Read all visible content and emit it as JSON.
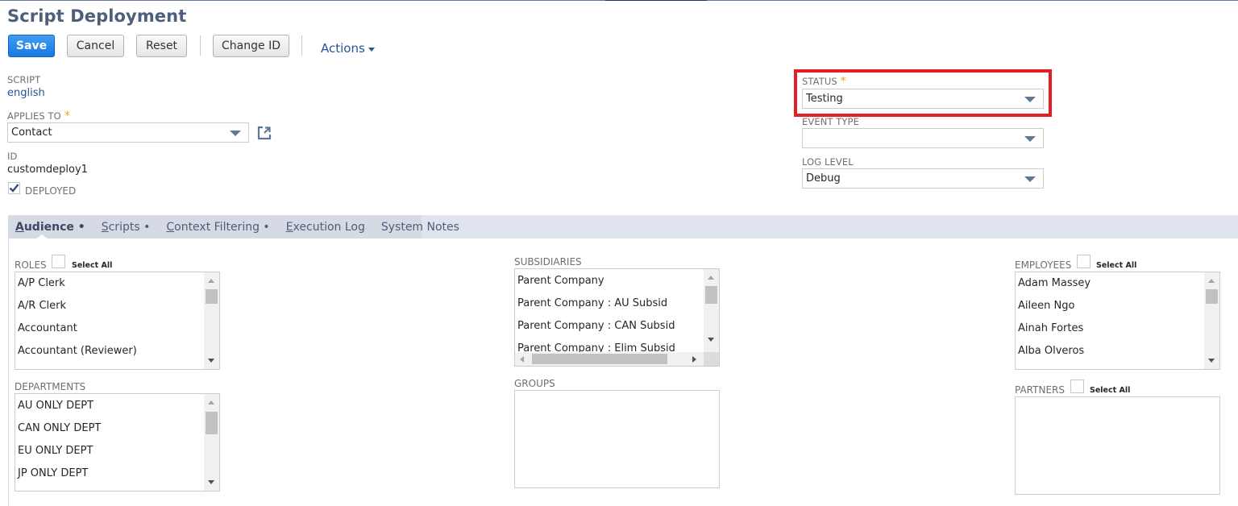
{
  "page": {
    "title": "Script Deployment"
  },
  "toolbar": {
    "save_label": "Save",
    "cancel_label": "Cancel",
    "reset_label": "Reset",
    "change_id_label": "Change ID",
    "actions_label": "Actions"
  },
  "fields": {
    "script": {
      "label": "SCRIPT",
      "value": "english"
    },
    "applies_to": {
      "label": "APPLIES TO",
      "required_mark": "*",
      "value": "Contact"
    },
    "id": {
      "label": "ID",
      "value": "customdeploy1"
    },
    "deployed": {
      "label": "DEPLOYED",
      "checked": true
    },
    "status": {
      "label": "STATUS",
      "required_mark": "*",
      "value": "Testing"
    },
    "event_type": {
      "label": "EVENT TYPE",
      "value": ""
    },
    "log_level": {
      "label": "LOG LEVEL",
      "value": "Debug"
    }
  },
  "colors": {
    "accent": "#1a78e0",
    "link": "#255599",
    "highlight_box": "#e21f26",
    "required": "#f2a21b"
  },
  "tabs": [
    {
      "label": "Audience",
      "access_key": "A",
      "rest": "udience",
      "dot": "•",
      "active": true
    },
    {
      "label": "Scripts",
      "access_key": "S",
      "rest": "cripts",
      "dot": "•",
      "active": false
    },
    {
      "label": "Context Filtering",
      "access_key": "C",
      "rest": "ontext Filtering",
      "dot": "•",
      "active": false
    },
    {
      "label": "Execution Log",
      "access_key": "E",
      "rest": "xecution Log",
      "dot": "",
      "active": false
    },
    {
      "label": "System Notes",
      "access_key": "",
      "rest": "System Notes",
      "dot": "",
      "active": false
    }
  ],
  "audience": {
    "select_all_label": "Select All",
    "roles": {
      "label": "ROLES",
      "items": [
        "A/P Clerk",
        "A/R Clerk",
        "Accountant",
        "Accountant (Reviewer)"
      ]
    },
    "departments": {
      "label": "DEPARTMENTS",
      "items": [
        "AU ONLY DEPT",
        "CAN ONLY DEPT",
        "EU ONLY DEPT",
        "JP ONLY DEPT"
      ]
    },
    "subsidiaries": {
      "label": "SUBSIDIARIES",
      "items": [
        "Parent Company",
        "Parent Company : AU Subsid",
        "Parent Company : CAN Subsid",
        "Parent Company : Elim Subsid"
      ]
    },
    "groups": {
      "label": "GROUPS",
      "items": []
    },
    "employees": {
      "label": "EMPLOYEES",
      "items": [
        "Adam Massey",
        "Aileen Ngo",
        "Ainah Fortes",
        "Alba Olveros"
      ]
    },
    "partners": {
      "label": "PARTNERS",
      "items": []
    }
  }
}
